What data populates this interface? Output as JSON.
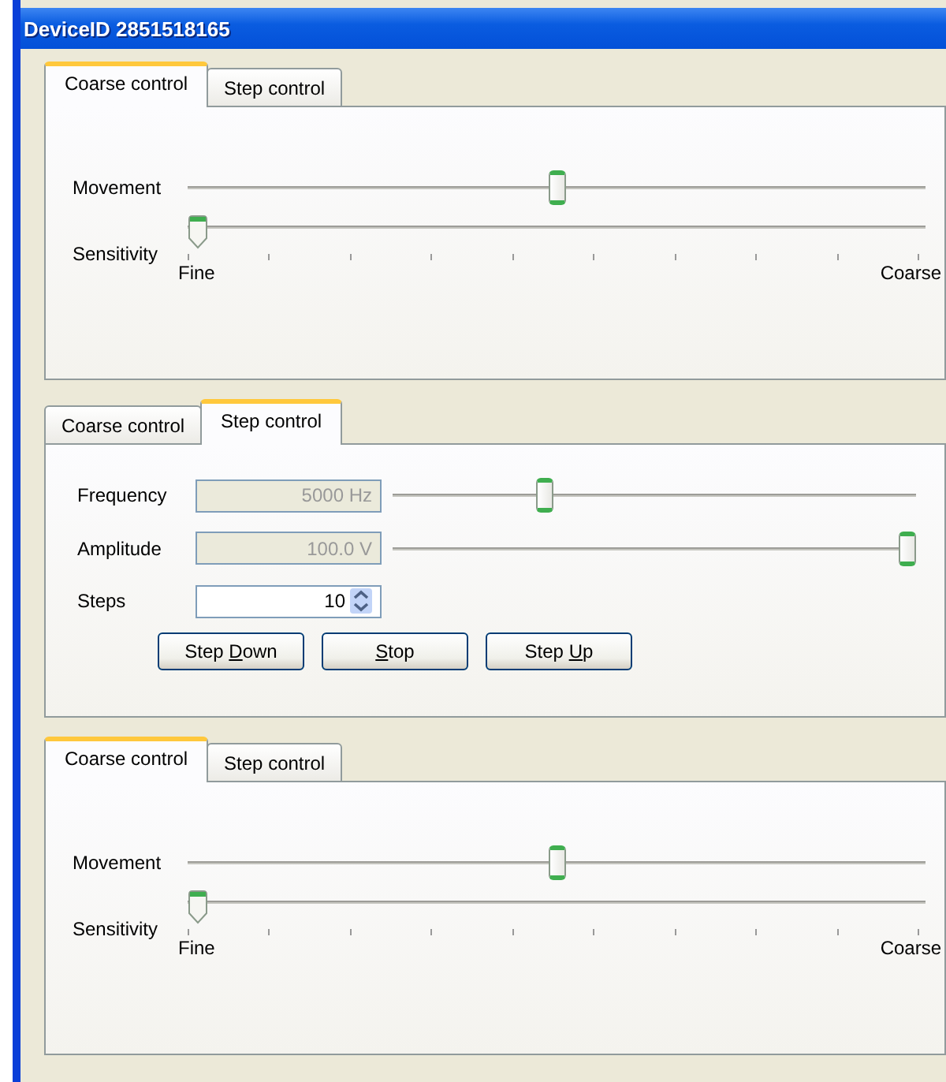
{
  "window": {
    "title": "DeviceID 2851518165"
  },
  "panels": [
    {
      "kind": "coarse",
      "tabs": [
        {
          "label": "Coarse control",
          "selected": true
        },
        {
          "label": "Step control",
          "selected": false
        }
      ],
      "movement": {
        "label": "Movement",
        "level": 0.5
      },
      "sensitivity": {
        "label": "Sensitivity",
        "level": 0,
        "min_label": "Fine",
        "max_label": "Coarse"
      }
    },
    {
      "kind": "step",
      "tabs": [
        {
          "label": "Coarse control",
          "selected": false
        },
        {
          "label": "Step control",
          "selected": true
        }
      ],
      "rows": [
        {
          "kind": "slider",
          "label": "Frequency",
          "value": "5000 Hz",
          "disabled": true,
          "level": 0.29
        },
        {
          "kind": "slider",
          "label": "Amplitude",
          "value": "100.0 V",
          "disabled": true,
          "level": 1
        },
        {
          "kind": "spinner",
          "label": "Steps",
          "value": "10",
          "disabled": false
        }
      ],
      "buttons": [
        {
          "text_before": "Step ",
          "access_key": "D",
          "text_after": "own"
        },
        {
          "access_key": "S",
          "text_after": "top"
        },
        {
          "text_before": "Step ",
          "access_key": "U",
          "text_after": "p"
        }
      ]
    },
    {
      "kind": "coarse",
      "tabs": [
        {
          "label": "Coarse control",
          "selected": true
        },
        {
          "label": "Step control",
          "selected": false
        }
      ],
      "movement": {
        "label": "Movement",
        "level": 0.5
      },
      "sensitivity": {
        "label": "Sensitivity",
        "level": 0,
        "min_label": "Fine",
        "max_label": "Coarse"
      }
    }
  ]
}
